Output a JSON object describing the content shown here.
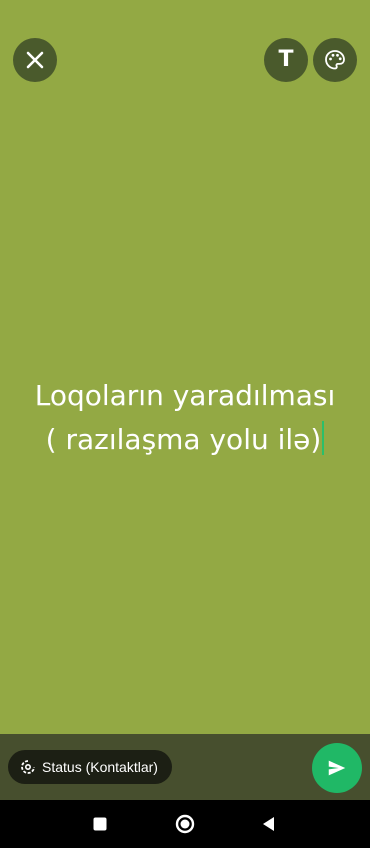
{
  "status_text": {
    "line1": "Loqoların yaradılması",
    "line2": "( razılaşma yolu ilə)"
  },
  "audience": {
    "label": "Status (Kontaktlar)"
  },
  "colors": {
    "background": "#93a944",
    "button_bg": "#4a5a2c",
    "bottom_bar": "#474f2e",
    "send": "#20b866",
    "caret": "#2bbf6a"
  },
  "icons": {
    "close": "close-icon",
    "text_style": "text-style-icon",
    "palette": "palette-icon",
    "audience": "status-icon",
    "send": "send-icon",
    "nav_recent": "recent-apps-icon",
    "nav_home": "home-icon",
    "nav_back": "back-icon"
  }
}
